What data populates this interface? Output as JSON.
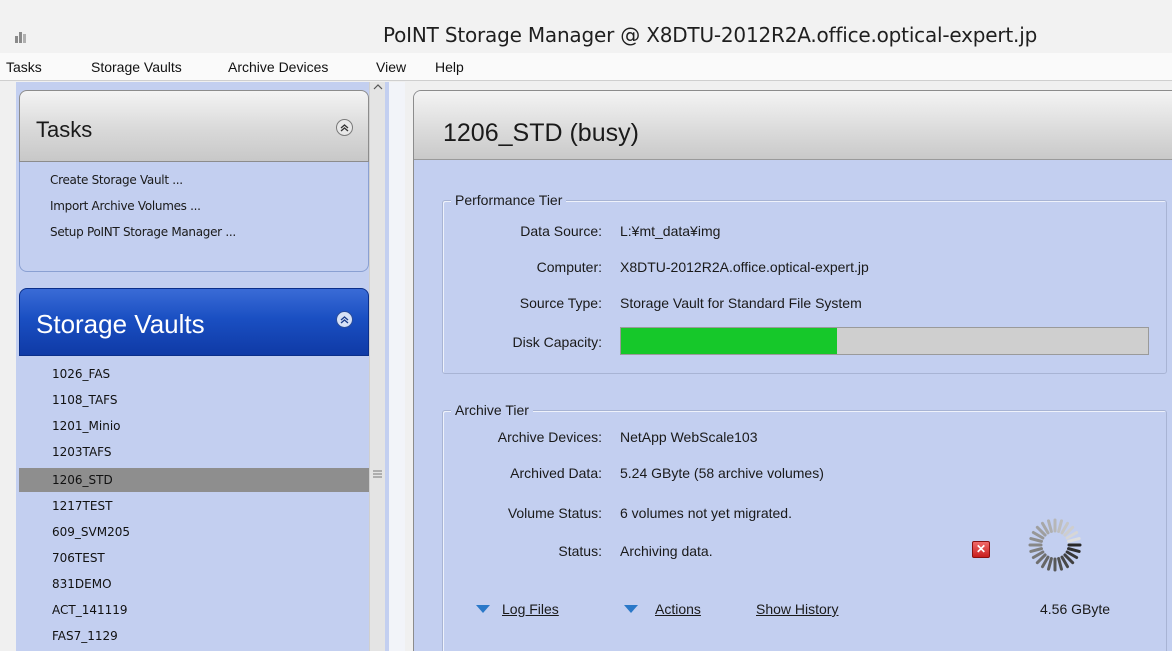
{
  "window": {
    "title": "PoINT Storage Manager @ X8DTU-2012R2A.office.optical-expert.jp",
    "icon": "app-icon"
  },
  "menu": [
    "Tasks",
    "Storage Vaults",
    "Archive Devices",
    "View",
    "Help"
  ],
  "tasks_panel": {
    "title": "Tasks",
    "collapse_glyph": "≈",
    "items": [
      "Create Storage Vault ...",
      "Import Archive Volumes ...",
      "Setup PoINT Storage Manager ..."
    ]
  },
  "vaults_panel": {
    "title": "Storage Vaults",
    "collapse_glyph": "≈",
    "selected_index": 4,
    "items": [
      "1026_FAS",
      "1108_TAFS",
      "1201_Minio",
      "1203TAFS",
      "1206_STD",
      "1217TEST",
      "609_SVM205",
      "706TEST",
      "831DEMO",
      "ACT_141119",
      "FAS7_1129"
    ]
  },
  "detail": {
    "title": "1206_STD (busy)",
    "performance_tier": {
      "legend": "Performance Tier",
      "fields": [
        {
          "label": "Data Source:",
          "value": "L:¥mt_data¥img"
        },
        {
          "label": "Computer:",
          "value": "X8DTU-2012R2A.office.optical-expert.jp"
        },
        {
          "label": "Source Type:",
          "value": "Storage Vault for Standard File System"
        }
      ],
      "capacity_label": "Disk Capacity:",
      "capacity_used_fraction": 0.41
    },
    "archive_tier": {
      "legend": "Archive Tier",
      "fields": [
        {
          "label": "Archive Devices:",
          "value": "NetApp WebScale103"
        },
        {
          "label": "Archived Data:",
          "value": "5.24 GByte (58 archive volumes)"
        },
        {
          "label": "Volume Status:",
          "value": "6 volumes not yet migrated."
        },
        {
          "label": "Status:",
          "value": "Archiving data."
        }
      ],
      "progress_size": "4.56 GByte",
      "error_glyph": "✕"
    },
    "actions": {
      "log_files": "Log Files",
      "actions": "Actions",
      "show_history": "Show History"
    }
  },
  "colors": {
    "panel_bg": "#c3cff0",
    "selected_bg": "#8e8e8e",
    "accent_blue": "#1a4fc2",
    "capacity_fill": "#16c82a",
    "link_triangle": "#2a78c8"
  }
}
